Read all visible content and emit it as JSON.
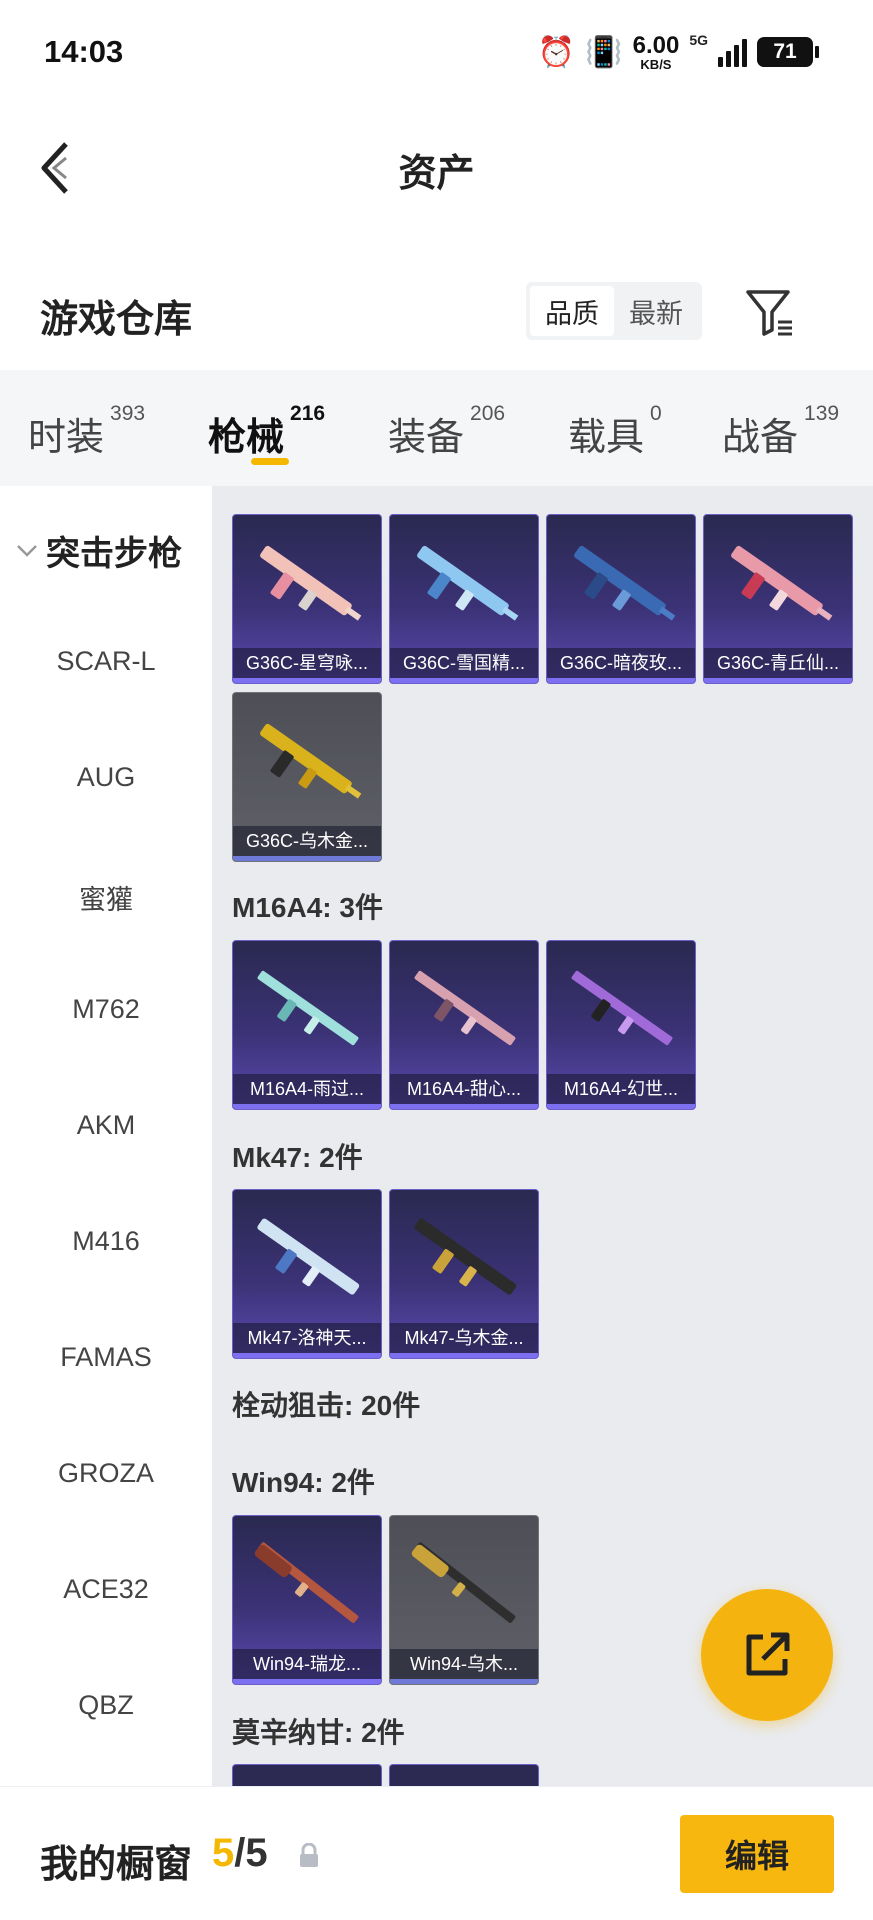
{
  "status_bar": {
    "time": "14:03",
    "net_speed": "6.00",
    "net_unit": "KB/S",
    "net_type": "5G",
    "battery": "71"
  },
  "header": {
    "title": "资产",
    "back_icon": "chevron-left-icon"
  },
  "warehouse": {
    "title": "游戏仓库",
    "sort_quality": "品质",
    "sort_newest": "最新",
    "active_sort": "品质"
  },
  "tabs": [
    {
      "label": "时装",
      "count": "393"
    },
    {
      "label": "枪械",
      "count": "216"
    },
    {
      "label": "装备",
      "count": "206"
    },
    {
      "label": "载具",
      "count": "0"
    },
    {
      "label": "战备",
      "count": "139"
    }
  ],
  "active_tab": "枪械",
  "sidebar": {
    "category": "突击步枪",
    "items": [
      "SCAR-L",
      "AUG",
      "蜜獾",
      "M762",
      "AKM",
      "M416",
      "FAMAS",
      "GROZA",
      "ACE32",
      "QBZ"
    ]
  },
  "content": {
    "g36c": {
      "items": [
        "G36C-星穹咏...",
        "G36C-雪国精...",
        "G36C-暗夜玫...",
        "G36C-青丘仙...",
        "G36C-乌木金..."
      ]
    },
    "m16a4": {
      "label": "M16A4: 3件",
      "items": [
        "M16A4-雨过...",
        "M16A4-甜心...",
        "M16A4-幻世..."
      ]
    },
    "mk47": {
      "label": "Mk47: 2件",
      "items": [
        "Mk47-洛神天...",
        "Mk47-乌木金..."
      ]
    },
    "bolt_action": {
      "label": "栓动狙击: 20件"
    },
    "win94": {
      "label": "Win94: 2件",
      "items": [
        "Win94-瑞龙...",
        "Win94-乌木..."
      ]
    },
    "mosin": {
      "label": "莫辛纳甘: 2件"
    }
  },
  "bottom": {
    "title": "我的橱窗",
    "current": "5",
    "separator": "/",
    "total": "5",
    "edit": "编辑"
  },
  "colors": {
    "accent": "#f5b800",
    "card_purple": "#3b3276",
    "card_gray": "#55565d"
  }
}
